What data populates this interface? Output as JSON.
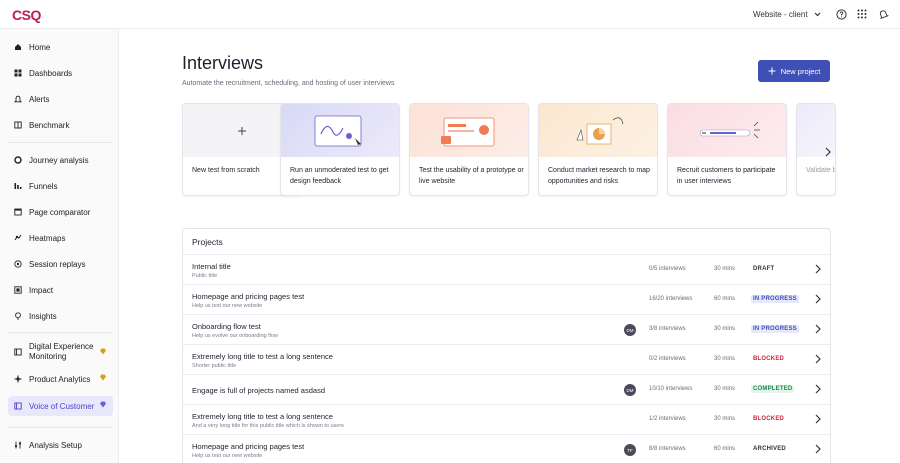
{
  "app": {
    "logo": "CSQ",
    "workspace": "Website - client"
  },
  "sidebar": {
    "items": [
      {
        "label": "Home"
      },
      {
        "label": "Dashboards"
      },
      {
        "label": "Alerts"
      },
      {
        "label": "Benchmark"
      },
      {
        "label": "Journey analysis"
      },
      {
        "label": "Funnels"
      },
      {
        "label": "Page comparator"
      },
      {
        "label": "Heatmaps"
      },
      {
        "label": "Session replays"
      },
      {
        "label": "Impact"
      },
      {
        "label": "Insights"
      },
      {
        "label": "Digital Experience Monitoring"
      },
      {
        "label": "Product Analytics"
      },
      {
        "label": "Voice of Customer"
      },
      {
        "label": "Analysis Setup"
      }
    ]
  },
  "page": {
    "title": "Interviews",
    "subtitle": "Automate the recruitment, scheduling, and hosting of user interviews",
    "new_project_label": "New project"
  },
  "cards": [
    {
      "label": "New test from scratch"
    },
    {
      "label": "Run an unmoderated test to get design feedback"
    },
    {
      "label": "Test the usability of a prototype or live website"
    },
    {
      "label": "Conduct market research to map opportunities and risks"
    },
    {
      "label": "Recruit customers to participate in user interviews"
    },
    {
      "label": "Validate business"
    }
  ],
  "projects": {
    "title": "Projects",
    "rows": [
      {
        "name": "Internal title",
        "public": "Public title",
        "avatar": "",
        "count": "0/5 interviews",
        "duration": "30 mins",
        "status": "DRAFT"
      },
      {
        "name": "Homepage and pricing pages test",
        "public": "Help us test our new website",
        "avatar": "",
        "count": "16/20 interviews",
        "duration": "60 mins",
        "status": "IN PROGRESS"
      },
      {
        "name": "Onboarding flow test",
        "public": "Help us evolve our onboarding flow",
        "avatar": "DM",
        "count": "3/8 interviews",
        "duration": "30 mins",
        "status": "IN PROGRESS"
      },
      {
        "name": "Extremely long title to test a long sentence",
        "public": "Shorter public title",
        "avatar": "",
        "count": "0/2 interviews",
        "duration": "30 mins",
        "status": "BLOCKED"
      },
      {
        "name": "Engage is full of projects named asdasd",
        "public": "",
        "avatar": "DM",
        "count": "10/10 interviews",
        "duration": "30 mins",
        "status": "COMPLETED"
      },
      {
        "name": "Extremely long title to test a long sentence",
        "public": "And a very long title for this public title which is shown to users",
        "avatar": "",
        "count": "1/2 interviews",
        "duration": "30 mins",
        "status": "BLOCKED"
      },
      {
        "name": "Homepage and pricing pages test",
        "public": "Help us test our new website",
        "avatar": "TF",
        "count": "8/8 interviews",
        "duration": "60 mins",
        "status": "ARCHIVED"
      }
    ]
  },
  "colors": {
    "brand": "#c2185b",
    "primary": "#3e4fb6",
    "active_bg": "#e9e8fb",
    "blocked": "#d2213b",
    "completed": "#1f8a4c",
    "premium": "#d4a017"
  }
}
